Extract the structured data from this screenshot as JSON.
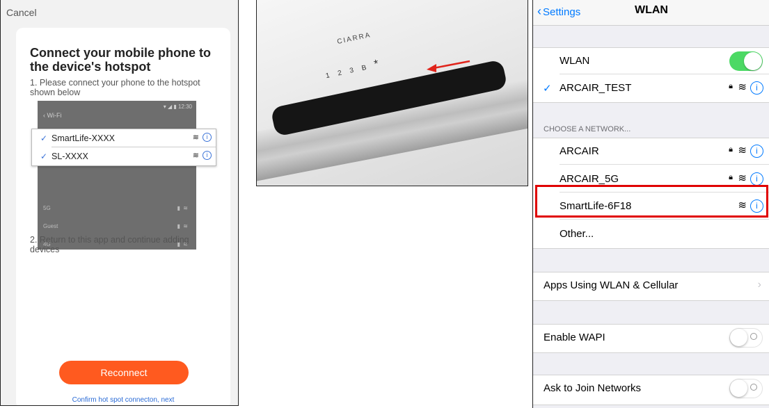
{
  "panel_app": {
    "cancel": "Cancel",
    "title": "Connect your mobile phone to the device's hotspot",
    "step1": "1. Please connect your phone to the hotspot shown below",
    "phone": {
      "status_time": "12:30",
      "wifi_title": "‹ Wi-Fi",
      "rows": [
        "5G",
        "Guest",
        "4G"
      ]
    },
    "popup": [
      {
        "label": "SmartLife-XXXX"
      },
      {
        "label": "SL-XXXX"
      }
    ],
    "step2": "2. Return to this app and continue adding devices",
    "reconnect": "Reconnect",
    "confirm_link": "Confirm hot spot connecton, next"
  },
  "panel_device": {
    "brand": "CIARRA",
    "keys": [
      "1",
      "2",
      "3",
      "B",
      "*"
    ]
  },
  "panel_settings": {
    "back": "Settings",
    "title": "WLAN",
    "wlan_label": "WLAN",
    "connected_network": "ARCAIR_TEST",
    "section_header": "CHOOSE A NETWORK...",
    "networks": [
      {
        "name": "ARCAIR",
        "locked": true
      },
      {
        "name": "ARCAIR_5G",
        "locked": true
      },
      {
        "name": "SmartLife-6F18",
        "locked": false
      }
    ],
    "other": "Other...",
    "apps_using": "Apps Using WLAN & Cellular",
    "enable_wapi": "Enable WAPI",
    "ask_to_join": "Ask to Join Networks",
    "wlan_on": true,
    "wapi_on": false,
    "ask_on": false
  },
  "colors": {
    "accent_orange": "#ff5a1f",
    "ios_blue": "#007aff",
    "ios_green": "#4cd964",
    "highlight_red": "#e00000"
  }
}
